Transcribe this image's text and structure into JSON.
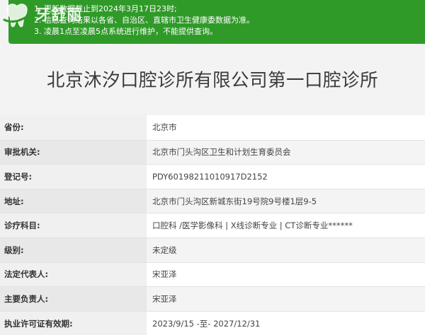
{
  "watermark": {
    "text": "牙舒丽"
  },
  "notice": {
    "lines": [
      "1. 更新数据截止到2024年3月17日23时;",
      "2. 信息查询结果以各省、自治区、直辖市卫生健康委数据为准。",
      "3. 凌晨1点至凌晨5点系统进行维护，不能提供查询。"
    ]
  },
  "title": "北京沐汐口腔诊所有限公司第一口腔诊所",
  "rows": [
    {
      "label": "省份:",
      "value": "北京市"
    },
    {
      "label": "审批机关:",
      "value": "北京市门头沟区卫生和计划生育委员会"
    },
    {
      "label": "登记号:",
      "value": "PDY60198211010917D2152"
    },
    {
      "label": "地址:",
      "value": "北京市门头沟区新城东街19号院9号楼1层9-5"
    },
    {
      "label": "诊疗科目:",
      "value": "口腔科 /医学影像科 | X线诊断专业 | CT诊断专业******"
    },
    {
      "label": "级别:",
      "value": "未定级"
    },
    {
      "label": "法定代表人:",
      "value": "宋亚泽"
    },
    {
      "label": "主要负责人:",
      "value": "宋亚泽"
    },
    {
      "label": "执业许可证有效期:",
      "value": "2023/9/15 -至- 2027/12/31"
    }
  ],
  "colors": {
    "banner": "#2f9a28",
    "title": "#3a3a3a"
  }
}
